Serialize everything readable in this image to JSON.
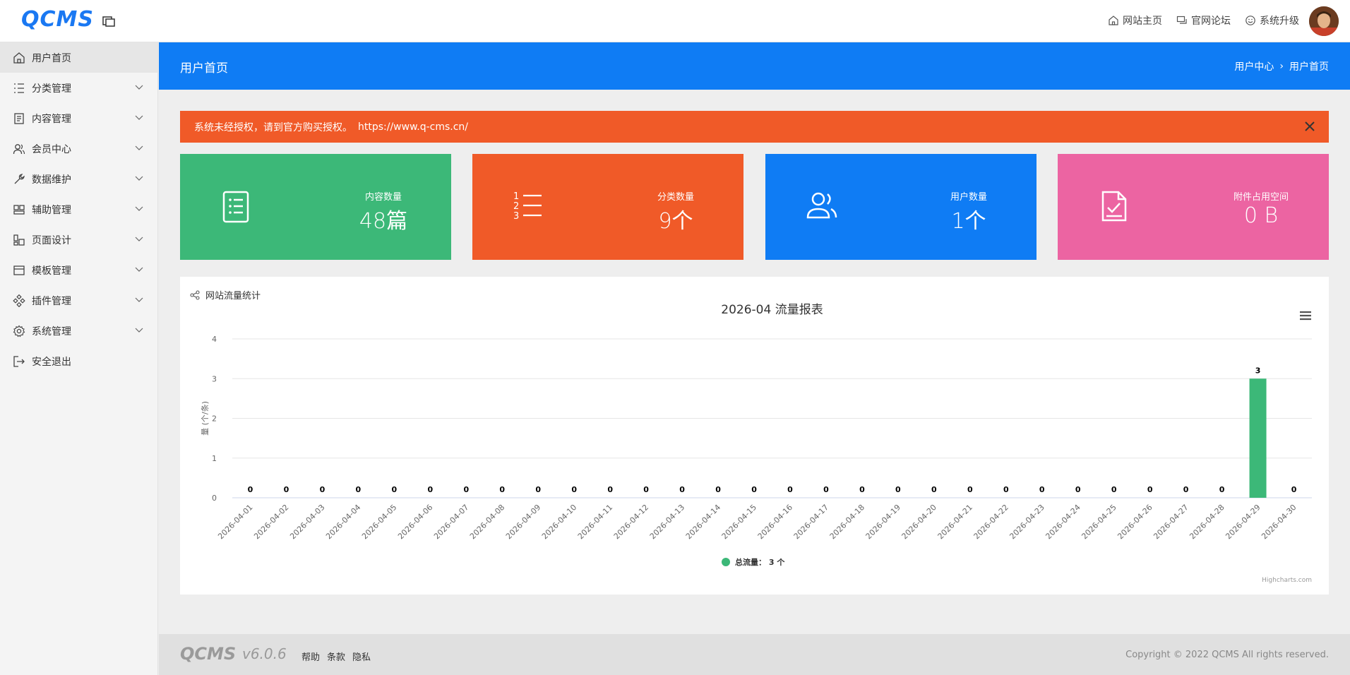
{
  "header": {
    "logo": "QCMS",
    "nav": [
      {
        "label": "网站主页",
        "icon": "home-icon"
      },
      {
        "label": "官网论坛",
        "icon": "forum-icon"
      },
      {
        "label": "系统升级",
        "icon": "upgrade-icon"
      }
    ]
  },
  "sidebar": {
    "items": [
      {
        "label": "用户首页",
        "icon": "home-icon",
        "active": true
      },
      {
        "label": "分类管理",
        "icon": "list-icon"
      },
      {
        "label": "内容管理",
        "icon": "document-icon"
      },
      {
        "label": "会员中心",
        "icon": "users-icon"
      },
      {
        "label": "数据维护",
        "icon": "wrench-icon"
      },
      {
        "label": "辅助管理",
        "icon": "layout-icon"
      },
      {
        "label": "页面设计",
        "icon": "design-icon"
      },
      {
        "label": "模板管理",
        "icon": "template-icon"
      },
      {
        "label": "插件管理",
        "icon": "plugin-icon"
      },
      {
        "label": "系统管理",
        "icon": "gear-icon"
      },
      {
        "label": "安全退出",
        "icon": "logout-icon"
      }
    ]
  },
  "page": {
    "title": "用户首页",
    "breadcrumb": [
      "用户中心",
      "用户首页"
    ]
  },
  "alert": {
    "text": "系统未经授权，请到官方购买授权。",
    "link": "https://www.q-cms.cn/"
  },
  "stats": [
    {
      "label": "内容数量",
      "value": "48篇",
      "icon": "list-doc-icon",
      "color": "#3cb878"
    },
    {
      "label": "分类数量",
      "value": "9个",
      "icon": "numbered-list-icon",
      "color": "#f05a28"
    },
    {
      "label": "用户数量",
      "value": "1个",
      "icon": "users-icon",
      "color": "#0f7cf4"
    },
    {
      "label": "附件占用空间",
      "value": "0 B",
      "icon": "file-check-icon",
      "color": "#ec64a2"
    }
  ],
  "chart_panel": {
    "title": "网站流量统计",
    "credits": "Highcharts.com"
  },
  "chart_data": {
    "type": "bar",
    "title": "2026-04 流量报表",
    "ylabel": "量 (个/条)",
    "xlabel": "",
    "ylim": [
      0,
      4
    ],
    "yticks": [
      0,
      1,
      2,
      3,
      4
    ],
    "grid": true,
    "legend_placement": "bottom-center",
    "categories": [
      "2026-04-01",
      "2026-04-02",
      "2026-04-03",
      "2026-04-04",
      "2026-04-05",
      "2026-04-06",
      "2026-04-07",
      "2026-04-08",
      "2026-04-09",
      "2026-04-10",
      "2026-04-11",
      "2026-04-12",
      "2026-04-13",
      "2026-04-14",
      "2026-04-15",
      "2026-04-16",
      "2026-04-17",
      "2026-04-18",
      "2026-04-19",
      "2026-04-20",
      "2026-04-21",
      "2026-04-22",
      "2026-04-23",
      "2026-04-24",
      "2026-04-25",
      "2026-04-26",
      "2026-04-27",
      "2026-04-28",
      "2026-04-29",
      "2026-04-30"
    ],
    "series": [
      {
        "name": "总流量",
        "legend_text": "总流量： 3 个",
        "color": "#3cb878",
        "values": [
          0,
          0,
          0,
          0,
          0,
          0,
          0,
          0,
          0,
          0,
          0,
          0,
          0,
          0,
          0,
          0,
          0,
          0,
          0,
          0,
          0,
          0,
          0,
          0,
          0,
          0,
          0,
          0,
          3,
          0
        ]
      }
    ]
  },
  "footer": {
    "logo": "QCMS",
    "version": "v6.0.6",
    "links": [
      "帮助",
      "条款",
      "隐私"
    ],
    "copyright": "Copyright © 2022 QCMS All rights reserved."
  }
}
